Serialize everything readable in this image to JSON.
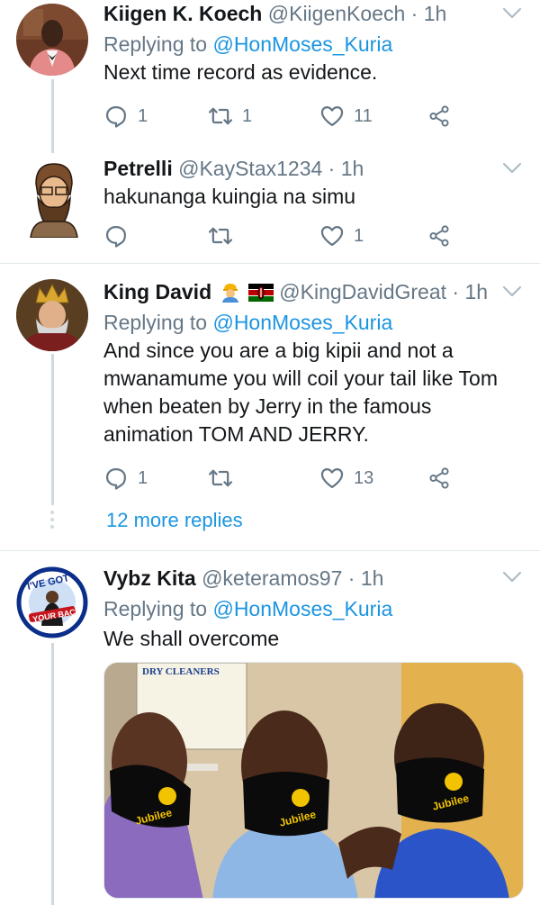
{
  "tweets": [
    {
      "name": "Kiigen K. Koech",
      "handle": "@KiigenKoech",
      "dot": "·",
      "time": "1h",
      "reply_prefix": "Replying to ",
      "reply_to": "@HonMoses_Kuria",
      "text": "Next time record as evidence.",
      "replies": "1",
      "retweets": "1",
      "likes": "11"
    },
    {
      "name": "Petrelli",
      "handle": "@KayStax1234",
      "dot": "·",
      "time": "1h",
      "text": "hakunanga kuingia na simu",
      "replies": "",
      "retweets": "",
      "likes": "1"
    },
    {
      "name": "King David",
      "handle": "@KingDavidGreat",
      "dot": "·",
      "time": "1h",
      "reply_prefix": "Replying to ",
      "reply_to": "@HonMoses_Kuria",
      "text": "And since you are a big kipii and not a mwanamume you will coil your tail like Tom when beaten by Jerry in the famous animation TOM AND JERRY.",
      "replies": "1",
      "retweets": "",
      "likes": "13",
      "more_replies": "12 more replies"
    },
    {
      "name": "Vybz Kita",
      "handle": "@keteramos97",
      "dot": "·",
      "time": "1h",
      "reply_prefix": "Replying to ",
      "reply_to": "@HonMoses_Kuria",
      "text": "We shall overcome",
      "avatar_text_top": "I'VE GOT",
      "avatar_text_bottom": "YOUR BACK",
      "media": {
        "sign_title": "DRY CLEANERS",
        "mask_text_1": "Jubilee",
        "mask_text_2": "Jubilee",
        "mask_text_3": "Jubilee"
      }
    }
  ],
  "colors": {
    "link": "#1b95e0",
    "muted": "#657786",
    "divider": "#e1e8ed"
  },
  "icons": [
    "reply-icon",
    "retweet-icon",
    "like-icon",
    "share-icon",
    "chevron-down-icon"
  ]
}
